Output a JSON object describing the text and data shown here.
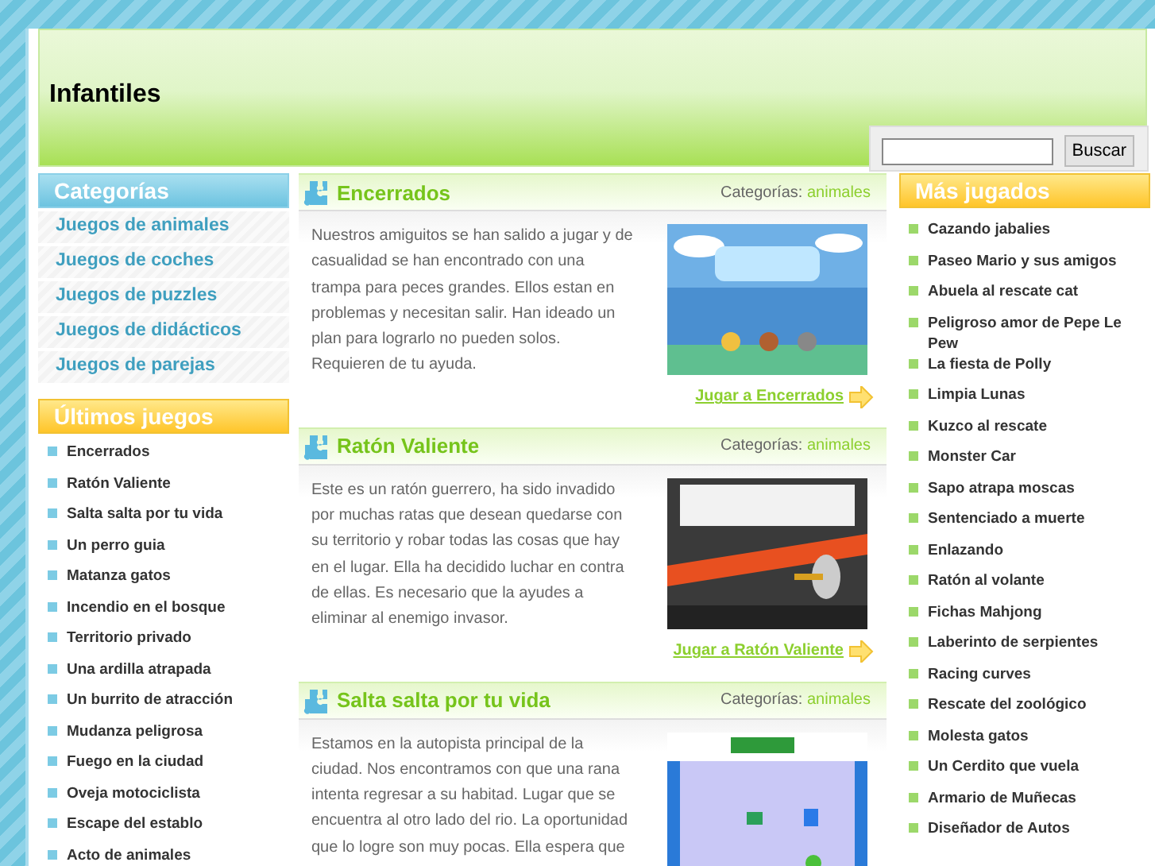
{
  "header": {
    "title": "Infantiles"
  },
  "search": {
    "button": "Buscar"
  },
  "categories": {
    "title": "Categorías",
    "items": [
      "Juegos de animales",
      "Juegos de coches",
      "Juegos de puzzles",
      "Juegos de didácticos",
      "Juegos de parejas"
    ]
  },
  "latest": {
    "title": "Últimos juegos",
    "items": [
      "Encerrados",
      "Ratón Valiente",
      "Salta salta por tu vida",
      "Un perro guia",
      "Matanza gatos",
      "Incendio en el bosque",
      "Territorio privado",
      "Una ardilla atrapada",
      "Un burrito de atracción",
      "Mudanza peligrosa",
      "Fuego en la ciudad",
      "Oveja motociclista",
      "Escape del establo",
      "Acto de animales"
    ]
  },
  "posts": [
    {
      "title": "Encerrados",
      "category_label": "Categorías:",
      "category": "animales",
      "text": "Nuestros amiguitos se han salido a jugar y de casualidad se han encontrado con una trampa para peces grandes. Ellos estan en problemas y necesitan salir. Han ideado un plan para lograrlo no pueden solos. Requieren de tu ayuda.",
      "play_link": "Jugar a Encerrados"
    },
    {
      "title": "Ratón Valiente",
      "category_label": "Categorías:",
      "category": "animales",
      "text": "Este es un ratón guerrero, ha sido invadido por muchas ratas que desean quedarse con su territorio y robar todas las cosas que hay en el lugar. Ella ha decidido luchar en contra de ellas. Es necesario que la ayudes a eliminar al enemigo invasor.",
      "play_link": "Jugar a Ratón Valiente"
    },
    {
      "title": "Salta salta por tu vida",
      "category_label": "Categorías:",
      "category": "animales",
      "text": "Estamos en la autopista principal de la ciudad. Nos encontramos con que una rana intenta regresar a su habitad. Lugar que se encuentra al otro lado del rio. La oportunidad que lo logre son muy pocas. Ella espera que"
    }
  ],
  "most_played": {
    "title": "Más jugados",
    "items": [
      "Cazando jabalies",
      "Paseo Mario y sus amigos",
      "Abuela al rescate cat",
      "Peligroso amor de Pepe Le Pew",
      "La fiesta de Polly",
      "Limpia Lunas",
      "Kuzco al rescate",
      "Monster Car",
      "Sapo atrapa moscas",
      "Sentenciado a muerte",
      "Enlazando",
      "Ratón al volante",
      "Fichas Mahjong",
      "Laberinto de serpientes",
      "Racing curves",
      "Rescate del zoológico",
      "Molesta gatos",
      "Un Cerdito que vuela",
      "Armario de Muñecas",
      "Diseñador de Autos"
    ]
  }
}
